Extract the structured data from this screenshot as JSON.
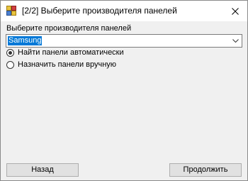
{
  "window": {
    "title": "[2/2] Выберите производителя панелей",
    "icon": "app-window-icon",
    "close_icon": "close-icon"
  },
  "form": {
    "label": "Выберите производителя панелей",
    "vendor_value": "Samsung",
    "options": [
      {
        "label": "Найти панели автоматически",
        "checked": true
      },
      {
        "label": "Назначить панели вручную",
        "checked": false
      }
    ]
  },
  "footer": {
    "back_label": "Назад",
    "continue_label": "Продолжить"
  },
  "colors": {
    "selection": "#0078d7",
    "window_bg": "#f0f0f0",
    "button_bg": "#e1e1e1"
  }
}
